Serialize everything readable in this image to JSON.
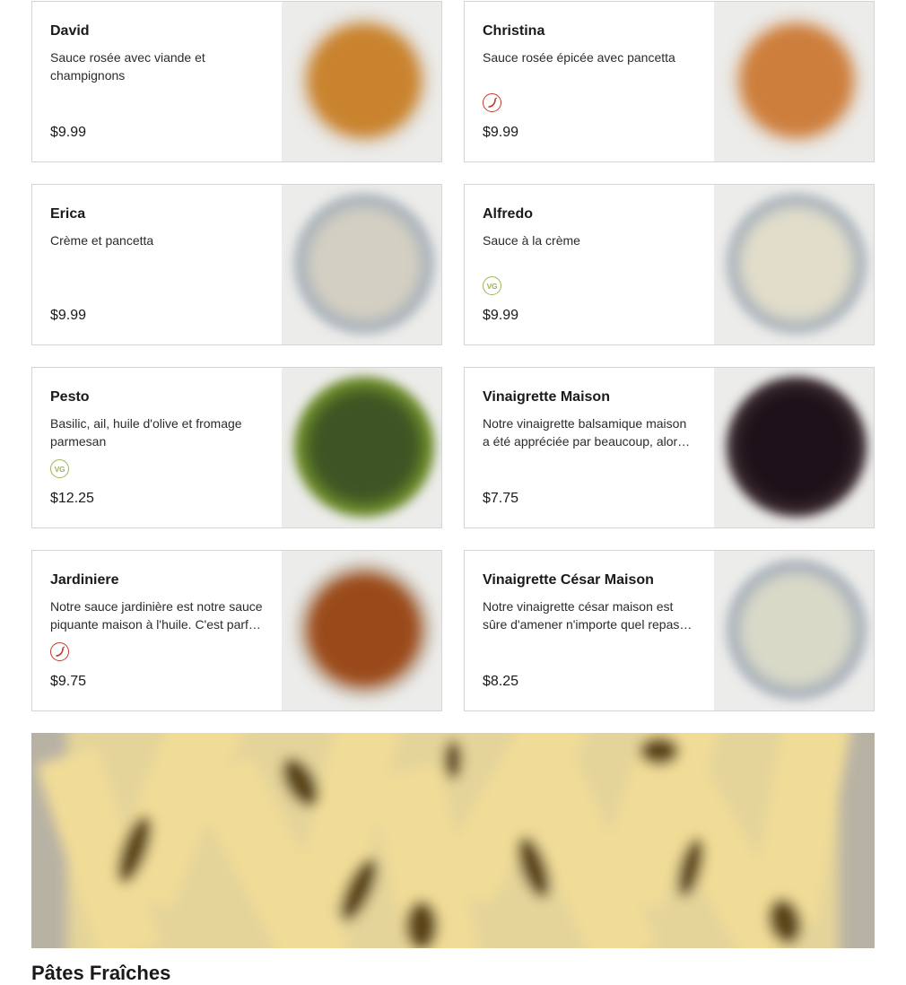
{
  "menu": {
    "items": [
      {
        "name": "David",
        "description": "Sauce rosée avec viande et champignons",
        "price": "$9.99",
        "badge": null,
        "image": "sauce-photo",
        "colors": {
          "bowl": "#e6e2dc",
          "sauce": "#c9832e"
        }
      },
      {
        "name": "Christina",
        "description": "Sauce rosée épicée avec pancetta",
        "price": "$9.99",
        "badge": "spicy-icon",
        "image": "sauce-photo",
        "colors": {
          "bowl": "#e9e4de",
          "sauce": "#cd7e3c"
        }
      },
      {
        "name": "Erica",
        "description": "Crème et pancetta",
        "price": "$9.99",
        "badge": null,
        "image": "sauce-photo",
        "colors": {
          "bowl": "#a9b2ba",
          "sauce": "#d3cfc2"
        }
      },
      {
        "name": "Alfredo",
        "description": "Sauce à la crème",
        "price": "$9.99",
        "badge": "vegetarian-icon",
        "badge_text": "VG",
        "image": "sauce-photo",
        "colors": {
          "bowl": "#aab3bb",
          "sauce": "#e1ddca"
        }
      },
      {
        "name": "Pesto",
        "description": "Basilic, ail, huile d'olive et fromage parmesan",
        "price": "$12.25",
        "badge": "vegetarian-icon",
        "badge_text": "VG",
        "image": "sauce-photo",
        "colors": {
          "bowl": "#6f8e2a",
          "sauce": "#3d5524"
        }
      },
      {
        "name": "Vinaigrette Maison",
        "description": "Notre vinaigrette balsamique maison a été appréciée par beaucoup, alors nous l'avons mise en bouteille pour vous.",
        "price": "$7.75",
        "badge": null,
        "image": "sauce-photo",
        "colors": {
          "bowl": "#3a2a30",
          "sauce": "#1e1119"
        }
      },
      {
        "name": "Jardiniere",
        "description": "Notre sauce jardinière est notre sauce piquante maison à l'huile. C'est parfait pour ajouter du piquant à vos plats.",
        "price": "$9.75",
        "badge": "spicy-icon",
        "image": "sauce-photo",
        "colors": {
          "bowl": "#d7d0c6",
          "sauce": "#9a4a1a"
        }
      },
      {
        "name": "Vinaigrette César Maison",
        "description": "Notre vinaigrette césar maison est sûre d'amener n'importe quel repas au niveau supérieur.",
        "price": "$8.25",
        "badge": null,
        "image": "sauce-photo",
        "colors": {
          "bowl": "#a8b1bb",
          "sauce": "#d9d9c8"
        }
      }
    ]
  },
  "banner": {
    "image": "pasta-banner-photo",
    "colors": {
      "base": "#e4d49a",
      "noodle": "#f1dc97",
      "shadow": "#5b4418",
      "rim": "#b8b2a4"
    }
  },
  "section": {
    "title": "Pâtes Fraîches"
  },
  "colors": {
    "border": "#d4d4d4",
    "text": "#1a1a1a",
    "vegetarian": "#9cb55a",
    "spicy": "#c0392b"
  }
}
